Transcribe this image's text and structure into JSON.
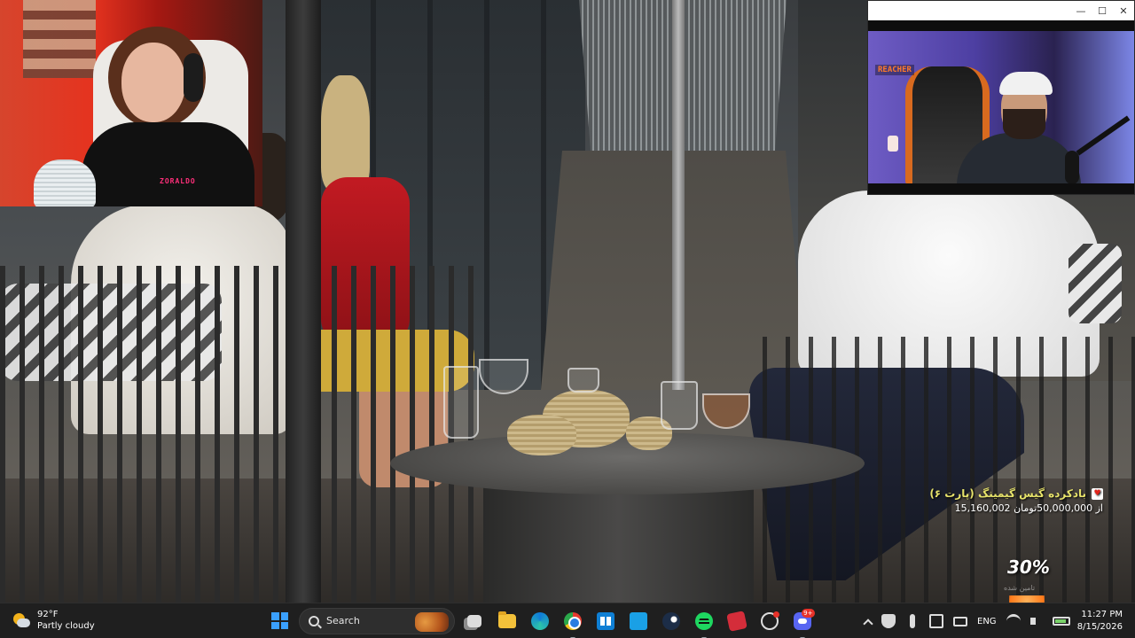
{
  "stream_window": {
    "minimize_glyph": "—",
    "maximize_glyph": "☐",
    "close_glyph": "✕",
    "sign_text": "REACHER"
  },
  "webcam": {
    "shirt_text": "ZORALDO"
  },
  "donation_goal": {
    "title": "بادکرده گیس گیمینگ (پارت ۶)",
    "amount_text": "15,160,002 از 50,000,000تومان",
    "progress_percent_label": "30%",
    "progress_percent": 30,
    "sub_label": "تامین شده",
    "heart_glyph": "♥"
  },
  "taskbar": {
    "weather": {
      "temperature": "92°F",
      "condition": "Partly cloudy"
    },
    "search": {
      "placeholder": "Search"
    },
    "pinned_icons": [
      "windows-start-icon",
      "search-icon",
      "task-view-icon",
      "file-explorer-icon",
      "edge-icon",
      "chrome-icon",
      "microsoft-store-icon",
      "sync-icon",
      "steam-icon",
      "spotify-icon",
      "cards-icon",
      "clock-app-icon",
      "discord-icon"
    ],
    "discord_badge": "9+",
    "tray": {
      "language": "ENG"
    },
    "clock": {
      "time": "11:27 PM",
      "date": "8/15/2026"
    }
  },
  "colors": {
    "taskbar_bg": "#1f1f1f",
    "accent_blue": "#3aa0ff",
    "goal_title": "#e6e26a",
    "discord": "#5865f2"
  }
}
